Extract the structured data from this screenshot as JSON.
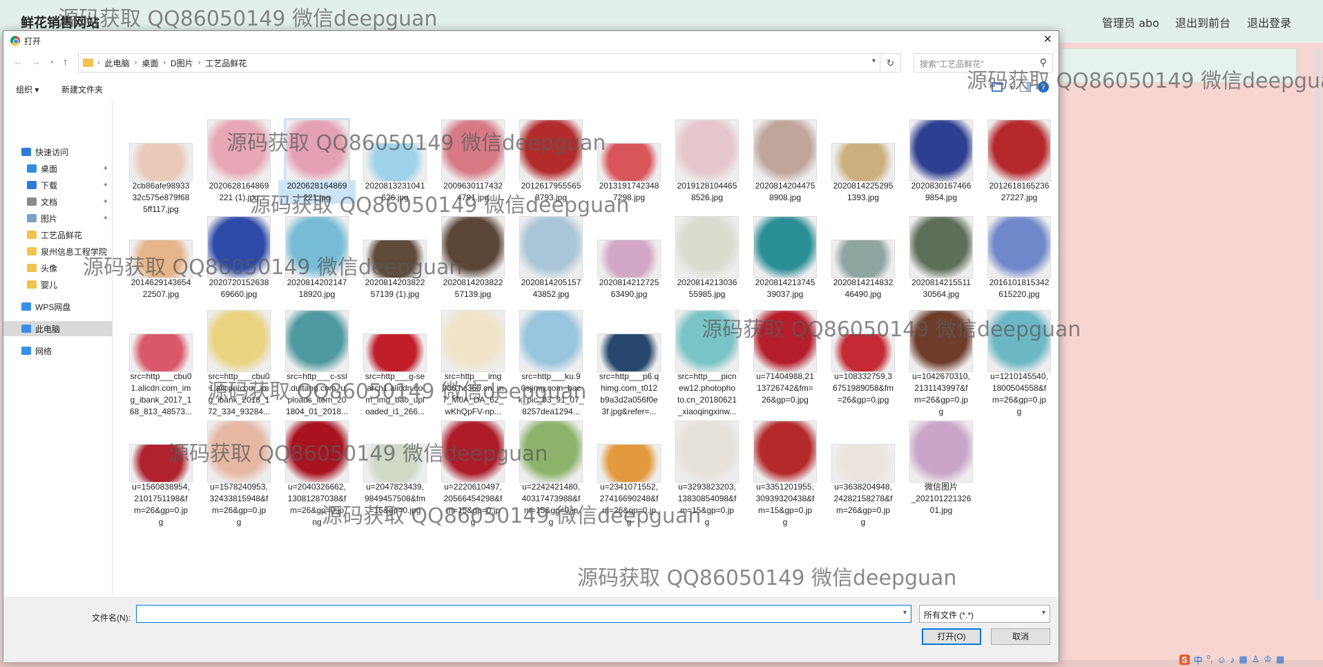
{
  "background_page": {
    "brand": "鲜花销售网站",
    "nav": [
      "管理员 abo",
      "退出到前台",
      "退出登录"
    ]
  },
  "watermark": "源码获取 QQ86050149 微信deepguan",
  "dialog": {
    "title": "打开",
    "close_icon": "×",
    "breadcrumbs": [
      "此电脑",
      "桌面",
      "D图片",
      "工艺品鲜花"
    ],
    "search_placeholder": "搜索\"工艺品鲜花\"",
    "toolbar": {
      "organize": "组织 ▾",
      "new_folder": "新建文件夹"
    },
    "nav_items": [
      {
        "label": "快速访问",
        "icon": "star-icon",
        "pinned": false
      },
      {
        "label": "桌面",
        "icon": "desktop-icon",
        "pinned": true
      },
      {
        "label": "下载",
        "icon": "download-icon",
        "pinned": true
      },
      {
        "label": "文档",
        "icon": "document-icon",
        "pinned": true
      },
      {
        "label": "图片",
        "icon": "pictures-icon",
        "pinned": true
      },
      {
        "label": "工艺品鲜花",
        "icon": "folder-icon",
        "pinned": false
      },
      {
        "label": "泉州信息工程学院",
        "icon": "folder-icon",
        "pinned": false
      },
      {
        "label": "头像",
        "icon": "folder-icon",
        "pinned": false
      },
      {
        "label": "婴儿",
        "icon": "folder-icon",
        "pinned": false
      },
      {
        "label": "WPS网盘",
        "icon": "cloud-icon",
        "pinned": false
      },
      {
        "label": "此电脑",
        "icon": "computer-icon",
        "pinned": false
      },
      {
        "label": "网络",
        "icon": "network-icon",
        "pinned": false
      }
    ],
    "files": [
      {
        "name": "2cb86afe98933\n32c575e879f68\n5ff117.jpg",
        "color": "#e9c9b8"
      },
      {
        "name": "2020628164869\n221 (1).jpg",
        "color": "#e7a7b6"
      },
      {
        "name": "2020628164869\n221.jpg",
        "color": "#e3a1b3"
      },
      {
        "name": "2020813231041\n626.jpg",
        "color": "#9fd3ea"
      },
      {
        "name": "2009630117432\n4791.jpg",
        "color": "#d77a86"
      },
      {
        "name": "2012617955565\n3793.jpg",
        "color": "#b22c2c"
      },
      {
        "name": "2013191742348\n7298.jpg",
        "color": "#d8555a"
      },
      {
        "name": "2019128104465\n8526.jpg",
        "color": "#e5c6cc"
      },
      {
        "name": "2020814204475\n8908.jpg",
        "color": "#bfa59a"
      },
      {
        "name": "2020814225295\n1393.jpg",
        "color": "#cbb07f"
      },
      {
        "name": "2020830167466\n9854.jpg",
        "color": "#2d3f91"
      },
      {
        "name": "2012618165236\n27227.jpg",
        "color": "#b5282b"
      },
      {
        "name": "2014629143654\n22507.jpg",
        "color": "#e7b58a"
      },
      {
        "name": "2020720152638\n69660.jpg",
        "color": "#2d4aa8"
      },
      {
        "name": "2020814202147\n18920.jpg",
        "color": "#76bcd5"
      },
      {
        "name": "2020814203822\n57139 (1).jpg",
        "color": "#5e4b3a"
      },
      {
        "name": "2020814203822\n57139.jpg",
        "color": "#5a4636"
      },
      {
        "name": "2020814205157\n43852.jpg",
        "color": "#a8c6d8"
      },
      {
        "name": "2020814212725\n63490.jpg",
        "color": "#d3a8c6"
      },
      {
        "name": "2020814213036\n55985.jpg",
        "color": "#dadcd0"
      },
      {
        "name": "2020814213745\n39037.jpg",
        "color": "#2a8f95"
      },
      {
        "name": "2020814214832\n46490.jpg",
        "color": "#8fa5a0"
      },
      {
        "name": "2020814215511\n30564.jpg",
        "color": "#5d6f58"
      },
      {
        "name": "2016101815342\n615220.jpg",
        "color": "#6f88c9"
      },
      {
        "name": "src=http___cbu0\n1.alicdn.com_im\ng_ibank_2017_1\n68_813_48573...",
        "color": "#d9586a"
      },
      {
        "name": "src=http___cbu0\n1.alicdn.com_im\ng_ibank_2018_1\n72_334_93284...",
        "color": "#e8d37f"
      },
      {
        "name": "src=http___c-ssl\n.duitang.com_u\nploads_item_20\n1804_01_2018...",
        "color": "#4f9aa0"
      },
      {
        "name": "src=http___g-se\narch1.alicdn.co\nm_img_bao_upl\noaded_i1_266...",
        "color": "#c01f2a"
      },
      {
        "name": "src=http___img\n006.hc360.cn_m\n7_M0A_DA_62_\nwKhQpFV-np...",
        "color": "#f0e4c8"
      },
      {
        "name": "src=http___ku.9\n0sjimg.com_bac\nk_pic_03_91_07_\n8257dea1294...",
        "color": "#98c5dd"
      },
      {
        "name": "src=http___p6.q\nhimg.com_t012\nb9a3d2a056f0e\n3f.jpg&refer=...",
        "color": "#28476e"
      },
      {
        "name": "src=http___picn\new12.photopho\nto.cn_20180621\n_xiaoqingxinw...",
        "color": "#79c4c6"
      },
      {
        "name": "u=71404988,21\n13726742&fm=\n26&gp=0.jpg",
        "color": "#b51d2a"
      },
      {
        "name": "u=108332759,3\n6751989058&fm\n=26&gp=0.jpg",
        "color": "#c42a33"
      },
      {
        "name": "u=1042670310,\n2131143997&f\nm=26&gp=0.jp\ng",
        "color": "#6e3d2a"
      },
      {
        "name": "u=1210145540,\n1800504558&f\nm=26&gp=0.jp\ng",
        "color": "#6cb8c4"
      },
      {
        "name": "u=1560838954,\n2101751198&f\nm=26&gp=0.jp\ng",
        "color": "#b0232e"
      },
      {
        "name": "u=1578240953,\n32433815948&f\nm=26&gp=0.jp\ng",
        "color": "#e6b8a4"
      },
      {
        "name": "u=2040326662,\n13081287038&f\nm=26&gp=0.jp\nng",
        "color": "#a8131f"
      },
      {
        "name": "u=2047823439,\n9849457508&fm\n=15&gp=0.jpg",
        "color": "#cfd9c6"
      },
      {
        "name": "u=2220610497,\n20566454298&f\nm=15&gp=0.jp\ng",
        "color": "#ad1c28"
      },
      {
        "name": "u=2242421480,\n40317473988&f\nm=15&gp=0.jp\ng",
        "color": "#8bb46a"
      },
      {
        "name": "u=2341071552,\n27416690248&f\nm=26&gp=0.jp\ng",
        "color": "#e39a3c"
      },
      {
        "name": "u=3293823203,\n13830854098&f\nm=15&gp=0.jp\ng",
        "color": "#e5e1d8"
      },
      {
        "name": "u=3351201955,\n30939320438&f\nm=15&gp=0.jp\ng",
        "color": "#b42a2a"
      },
      {
        "name": "u=3638204948,\n24282158278&f\nm=26&gp=0.jp\ng",
        "color": "#eae4dc"
      },
      {
        "name": "微信图片\n_202101221326\n01.jpg",
        "color": "#c9a6c8"
      }
    ],
    "filename_label": "文件名(N):",
    "filename_value": "",
    "filter_value": "所有文件 (*.*)",
    "open_button": "打开(O)",
    "cancel_button": "取消"
  }
}
